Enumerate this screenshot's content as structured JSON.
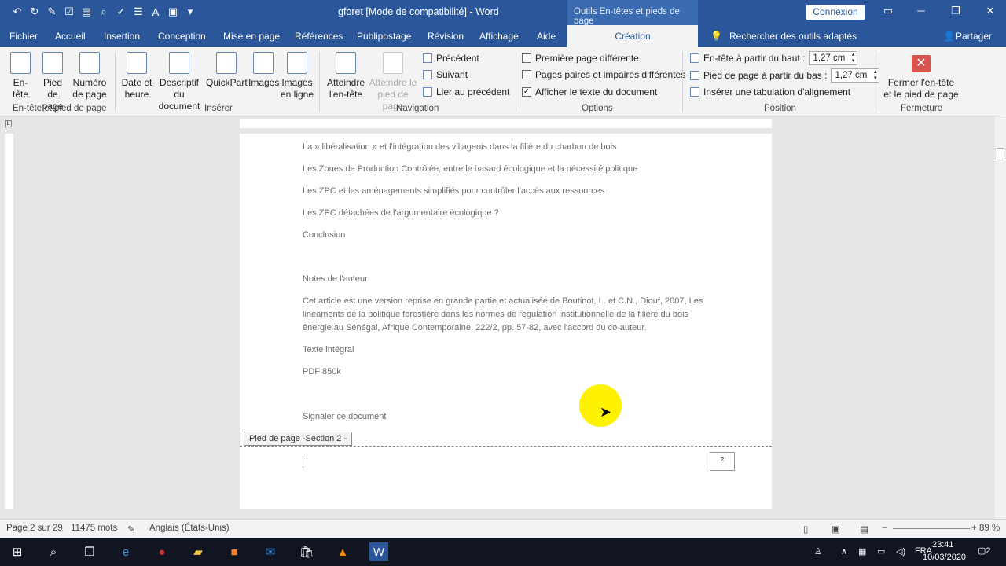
{
  "titlebar": {
    "doc_title": "gforet [Mode de compatibilité]  -  Word",
    "context_title": "Outils En-têtes et pieds de page",
    "connexion": "Connexion"
  },
  "tabs": [
    "Fichier",
    "Accueil",
    "Insertion",
    "Conception",
    "Mise en page",
    "Références",
    "Publipostage",
    "Révision",
    "Affichage",
    "Aide",
    "Création"
  ],
  "search_label": "Rechercher des outils adaptés",
  "share_label": "Partager",
  "ribbon": {
    "entete": [
      "En-",
      "tête"
    ],
    "pied": [
      "Pied de",
      "page"
    ],
    "numero": [
      "Numéro",
      "de page"
    ],
    "group_hf": "En-tête et pied de page",
    "date": [
      "Date et",
      "heure"
    ],
    "descriptif": [
      "Descriptif du",
      "document"
    ],
    "quickpart": "QuickPart",
    "images": "Images",
    "images_ligne": [
      "Images",
      "en ligne"
    ],
    "group_insert": "Insérer",
    "atteindre_entete": [
      "Atteindre",
      "l'en-tête"
    ],
    "atteindre_pied": [
      "Atteindre le",
      "pied de page"
    ],
    "precedent": "Précédent",
    "suivant": "Suivant",
    "lier": "Lier au précédent",
    "group_nav": "Navigation",
    "opt1": "Première page différente",
    "opt2": "Pages paires et impaires différentes",
    "opt3": "Afficher le texte du document",
    "group_opt": "Options",
    "pos1": "En-tête à partir du haut :",
    "pos1_val": "1,27 cm",
    "pos2": "Pied de page à partir du bas :",
    "pos2_val": "1,27 cm",
    "pos3": "Insérer une tabulation d'alignement",
    "group_pos": "Position",
    "fermer": [
      "Fermer l'en-tête",
      "et le pied de page"
    ],
    "group_close": "Fermeture"
  },
  "document": {
    "lines": [
      "La » libéralisation » et l'intégration des villageois dans la filière du charbon de bois",
      "Les Zones de Production Contrôlée, entre le hasard écologique et la nécessité politique",
      "Les ZPC et les aménagements simplifiés pour contrôler l'accès aux ressources",
      "Les ZPC détachées de l'argumentaire écologique ?",
      "Conclusion",
      "Notes de l'auteur",
      "Cet article est une version reprise en grande partie et actualisée de Boutinot, L. et C.N., Diouf, 2007, Les",
      "linéaments de la politique forestière dans les normes de régulation institutionnelle de la filière du bois",
      "énergie au Sénégal, Afrique Contemporaine, 222/2, pp. 57-82, avec l'accord du co-auteur.",
      "Texte intégral",
      "PDF 850k",
      "Signaler ce document"
    ],
    "footer_tag": "Pied de page -Section 2 -",
    "page_number": "2"
  },
  "status": {
    "page": "Page 2 sur 29",
    "words": "11475 mots",
    "language": "Anglais (États-Unis)",
    "zoom": "89 %"
  },
  "taskbar": {
    "lang": "FRA",
    "time": "23:41",
    "date": "10/03/2020",
    "notif": "2"
  }
}
